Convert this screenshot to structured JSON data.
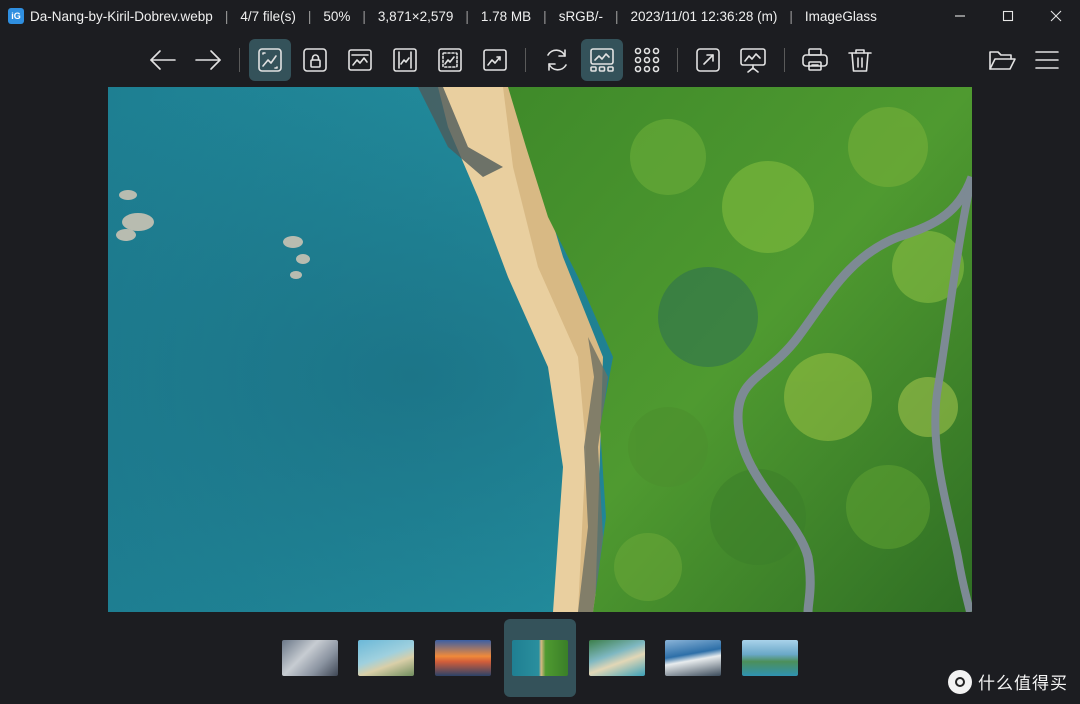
{
  "app": {
    "icon_glyph": "iG",
    "file_name": "Da-Nang-by-Kiril-Dobrev.webp",
    "file_index": "4/7 file(s)",
    "zoom": "50%",
    "dimensions": "3,871×2,579",
    "file_size": "1.78 MB",
    "color_profile": "sRGB/-",
    "modified": "2023/11/01 12:36:28 (m)",
    "app_name": "ImageGlass",
    "separator": "|"
  },
  "toolbar": {
    "buttons": [
      {
        "name": "previous-image-button",
        "icon": "arrow-left-icon",
        "active": false
      },
      {
        "name": "next-image-button",
        "icon": "arrow-right-icon",
        "active": false
      },
      {
        "name": "auto-zoom-button",
        "icon": "auto-zoom-icon",
        "active": true
      },
      {
        "name": "lock-zoom-button",
        "icon": "lock-zoom-icon",
        "active": false
      },
      {
        "name": "scale-to-width-button",
        "icon": "scale-width-icon",
        "active": false
      },
      {
        "name": "scale-to-height-button",
        "icon": "scale-height-icon",
        "active": false
      },
      {
        "name": "scale-to-fit-button",
        "icon": "scale-fit-icon",
        "active": false
      },
      {
        "name": "scale-to-fill-button",
        "icon": "scale-fill-icon",
        "active": false
      },
      {
        "name": "refresh-button",
        "icon": "refresh-icon",
        "active": false
      },
      {
        "name": "gallery-toggle-button",
        "icon": "gallery-icon",
        "active": true
      },
      {
        "name": "thumbnail-grid-button",
        "icon": "grid-icon",
        "active": false
      },
      {
        "name": "fullscreen-button",
        "icon": "fullscreen-icon",
        "active": false
      },
      {
        "name": "slideshow-button",
        "icon": "slideshow-icon",
        "active": false
      },
      {
        "name": "print-button",
        "icon": "print-icon",
        "active": false
      },
      {
        "name": "delete-button",
        "icon": "trash-icon",
        "active": false
      },
      {
        "name": "open-file-button",
        "icon": "folder-open-icon",
        "active": false
      },
      {
        "name": "main-menu-button",
        "icon": "hamburger-icon",
        "active": false
      }
    ]
  },
  "thumbnails": [
    {
      "name": "thumbnail-1",
      "active": false
    },
    {
      "name": "thumbnail-2",
      "active": false
    },
    {
      "name": "thumbnail-3",
      "active": false
    },
    {
      "name": "thumbnail-4",
      "active": true
    },
    {
      "name": "thumbnail-5",
      "active": false
    },
    {
      "name": "thumbnail-6",
      "active": false
    },
    {
      "name": "thumbnail-7",
      "active": false
    }
  ],
  "watermark": {
    "text": "什么值得买"
  },
  "colors": {
    "background": "#1c1d21",
    "active_button": "#34525a",
    "icon_stroke": "#e2e2e2"
  }
}
